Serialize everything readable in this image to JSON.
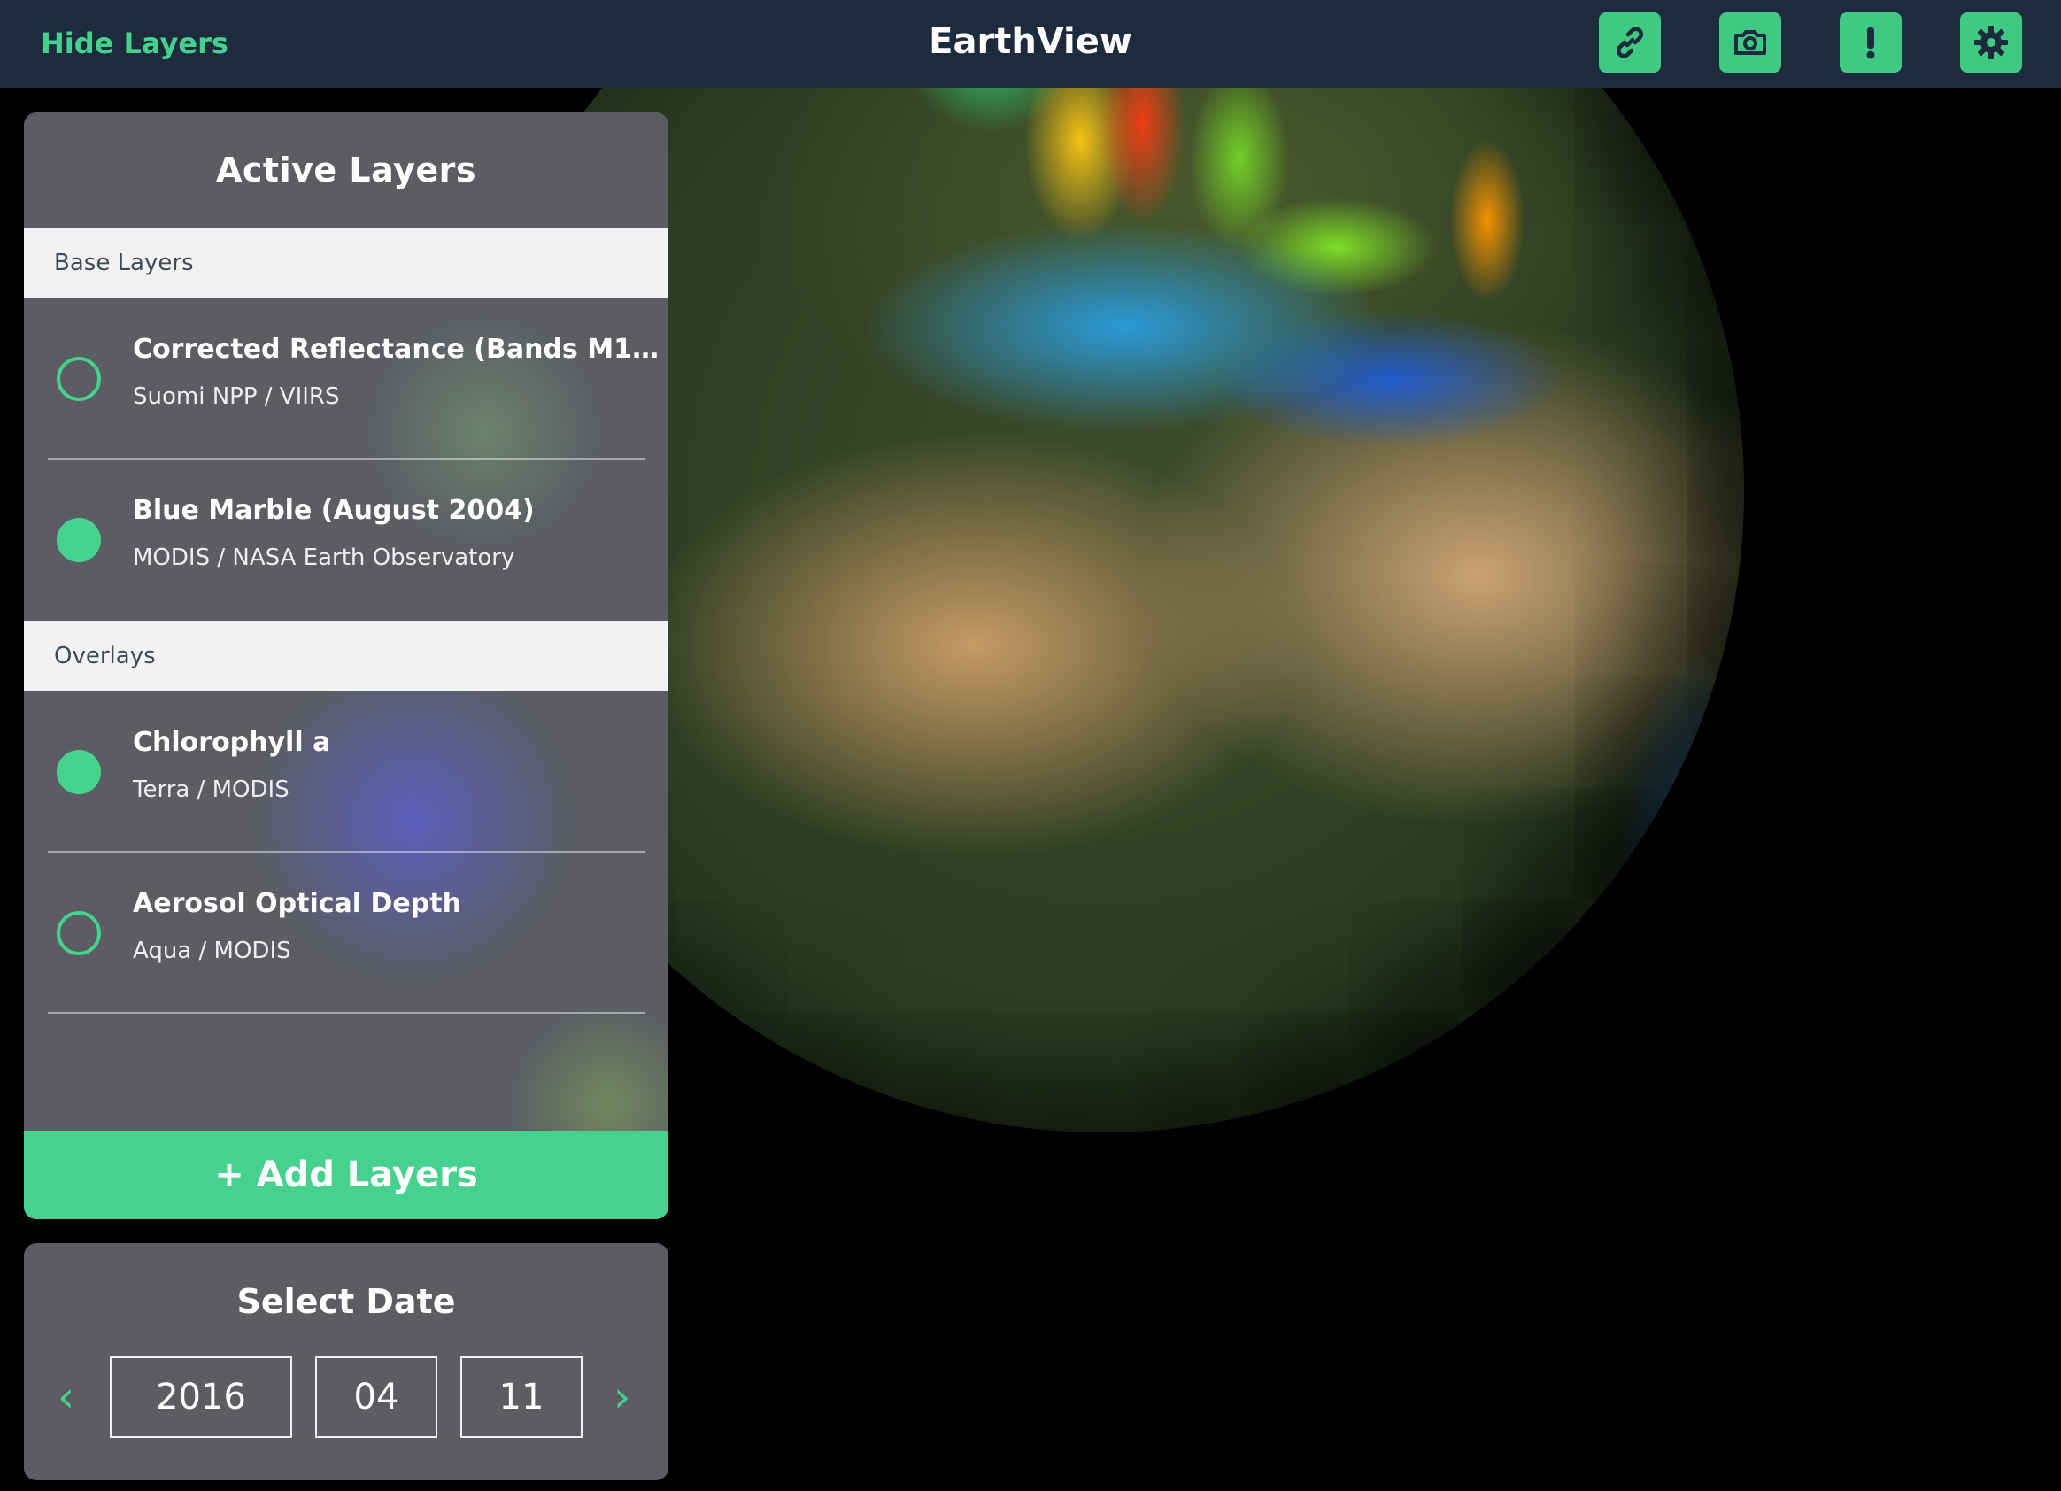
{
  "topbar": {
    "hide_layers_label": "Hide Layers",
    "title": "EarthView",
    "buttons": [
      "link-icon",
      "camera-icon",
      "exclamation-icon",
      "gear-icon"
    ]
  },
  "layers_panel": {
    "title": "Active Layers",
    "base_section_label": "Base Layers",
    "base_layers": [
      {
        "title": "Corrected Reflectance (Bands M1…",
        "source": "Suomi NPP / VIIRS",
        "active": false
      },
      {
        "title": "Blue Marble (August 2004)",
        "source": "MODIS / NASA Earth Observatory",
        "active": true
      }
    ],
    "overlay_section_label": "Overlays",
    "overlays": [
      {
        "title": "Chlorophyll a",
        "source": "Terra / MODIS",
        "active": true
      },
      {
        "title": "Aerosol Optical Depth",
        "source": "Aqua / MODIS",
        "active": false
      }
    ],
    "add_layers_label": "+ Add Layers"
  },
  "date_panel": {
    "title": "Select Date",
    "year": "2016",
    "month": "04",
    "day": "11",
    "prev_icon": "chevron-left-icon",
    "next_icon": "chevron-right-icon"
  },
  "colors": {
    "accent": "#46d18f",
    "topbar_bg": "#1d2b3d",
    "panel_bg": "#5b5d63",
    "section_bg": "#f2f2f2"
  }
}
